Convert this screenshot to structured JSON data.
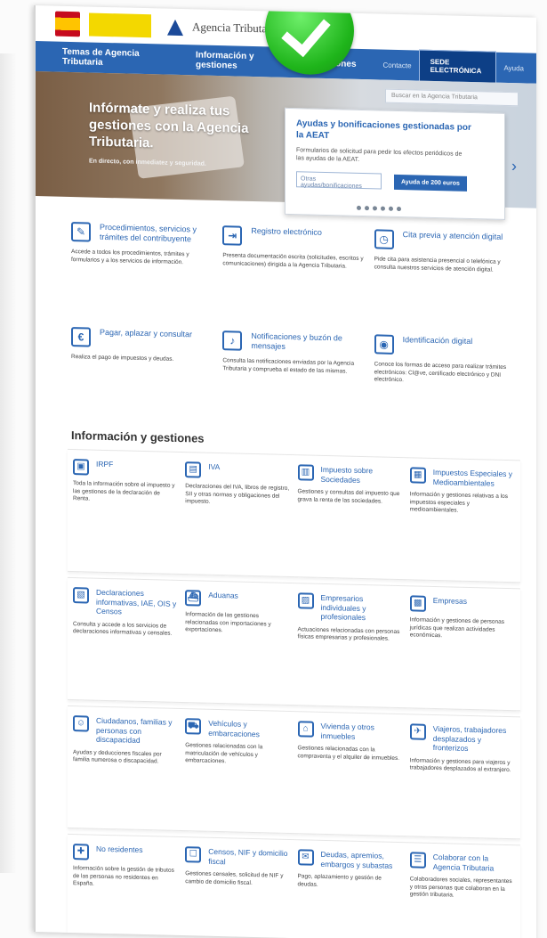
{
  "brand": {
    "agency_name": "Agencia Tributaria"
  },
  "nav": {
    "items": [
      "Temas de Agencia Tributaria",
      "Información y gestiones",
      "Gestiones"
    ],
    "links": [
      "Contacte",
      "Ayuda"
    ],
    "sede_button": "SEDE ELECTRÓNICA",
    "search_placeholder": "Buscar en la Agencia Tributaria"
  },
  "hero": {
    "title": "Infórmate y realiza tus gestiones con la Agencia Tributaria.",
    "subtitle": "En directo, con inmediatez y seguridad."
  },
  "hero_card": {
    "title": "Ayudas y bonificaciones gestionadas por la AEAT",
    "text": "Formularios de solicitud para pedir los efectos periódicos de las ayudas de la AEAT.",
    "input_placeholder": "Otras ayudas/bonificaciones",
    "button": "Ayuda de 200 euros",
    "arrow": "›"
  },
  "services": [
    {
      "icon": "✎",
      "icon_name": "edit-icon",
      "title": "Procedimientos, servicios y trámites del contribuyente",
      "desc": "Accede a todos los procedimientos, trámites y formularios y a los servicios de información."
    },
    {
      "icon": "⇥",
      "icon_name": "register-icon",
      "title": "Registro electrónico",
      "desc": "Presenta documentación escrita (solicitudes, escritos y comunicaciones) dirigida a la Agencia Tributaria."
    },
    {
      "icon": "◷",
      "icon_name": "calendar-clock-icon",
      "title": "Cita previa y atención digital",
      "desc": "Pide cita para asistencia presencial o telefónica y consulta nuestros servicios de atención digital."
    },
    {
      "icon": "€",
      "icon_name": "euro-icon",
      "title": "Pagar, aplazar y consultar",
      "desc": "Realiza el pago de impuestos y deudas."
    },
    {
      "icon": "♪",
      "icon_name": "bell-icon",
      "title": "Notificaciones y buzón de mensajes",
      "desc": "Consulta las notificaciones enviadas por la Agencia Tributaria y comprueba el estado de las mismas."
    },
    {
      "icon": "◉",
      "icon_name": "fingerprint-icon",
      "title": "Identificación digital",
      "desc": "Conoce los formas de acceso para realizar trámites electrónicos: Cl@ve, certificado electrónico y DNI electrónico."
    }
  ],
  "info_title": "Información y gestiones",
  "info_blocks": [
    [
      {
        "icon": "▣",
        "icon_name": "irpf-icon",
        "title": "IRPF",
        "desc": "Toda la información sobre el impuesto y las gestiones de la declaración de Renta."
      },
      {
        "icon": "▤",
        "icon_name": "iva-icon",
        "title": "IVA",
        "desc": "Declaraciones del IVA, libros de registro, SII y otras normas y obligaciones del impuesto."
      },
      {
        "icon": "▥",
        "icon_name": "sociedades-icon",
        "title": "Impuesto sobre Sociedades",
        "desc": "Gestiones y consultas del impuesto que grava la renta de las sociedades."
      },
      {
        "icon": "▦",
        "icon_name": "document-icon",
        "title": "Impuestos Especiales y Medioambientales",
        "desc": "Información y gestiones relativas a los impuestos especiales y medioambientales."
      }
    ],
    [
      {
        "icon": "▧",
        "icon_name": "declarations-icon",
        "title": "Declaraciones informativas, IAE, OIS y Censos",
        "desc": "Consulta y accede a los servicios de declaraciones informativas y censales."
      },
      {
        "icon": "⛴",
        "icon_name": "ship-icon",
        "title": "Aduanas",
        "desc": "Información de las gestiones relacionadas con importaciones y exportaciones."
      },
      {
        "icon": "▨",
        "icon_name": "briefcase-icon",
        "title": "Empresarios individuales y profesionales",
        "desc": "Actuaciones relacionadas con personas físicas empresarias y profesionales."
      },
      {
        "icon": "▩",
        "icon_name": "chart-icon",
        "title": "Empresas",
        "desc": "Información y gestiones de personas jurídicas que realizan actividades económicas."
      }
    ],
    [
      {
        "icon": "☺",
        "icon_name": "family-icon",
        "title": "Ciudadanos, familias y personas con discapacidad",
        "desc": "Ayudas y deducciones fiscales por familia numerosa o discapacidad."
      },
      {
        "icon": "⛟",
        "icon_name": "vehicle-icon",
        "title": "Vehículos y embarcaciones",
        "desc": "Gestiones relacionadas con la matriculación de vehículos y embarcaciones."
      },
      {
        "icon": "⌂",
        "icon_name": "house-icon",
        "title": "Vivienda y otros inmuebles",
        "desc": "Gestiones relacionadas con la compraventa y el alquiler de inmuebles."
      },
      {
        "icon": "✈",
        "icon_name": "suitcase-icon",
        "title": "Viajeros, trabajadores desplazados y fronterizos",
        "desc": "Información y gestiones para viajeros y trabajadores desplazados al extranjero."
      }
    ],
    [
      {
        "icon": "✚",
        "icon_name": "signpost-icon",
        "title": "No residentes",
        "desc": "Información sobre la gestión de tributos de las personas no residentes en España."
      },
      {
        "icon": "☐",
        "icon_name": "id-card-icon",
        "title": "Censos, NIF y domicilio fiscal",
        "desc": "Gestiones censales, solicitud de NIF y cambio de domicilio fiscal."
      },
      {
        "icon": "✉",
        "icon_name": "debts-icon",
        "title": "Deudas, apremios, embargos y subastas",
        "desc": "Pago, aplazamiento y gestión de deudas."
      },
      {
        "icon": "☰",
        "icon_name": "colaborar-icon",
        "title": "Colaborar con la Agencia Tributaria",
        "desc": "Colaboradores sociales, representantes y otras personas que colaboran en la gestión tributaria."
      }
    ]
  ]
}
